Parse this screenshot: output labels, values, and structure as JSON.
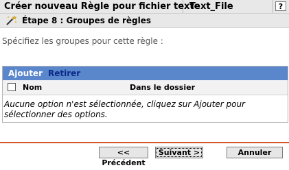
{
  "header": {
    "title": "Créer nouveau Règle pour fichier texte",
    "subtitle": "Text_File",
    "help_label": "?"
  },
  "step": {
    "icon": "wand-icon",
    "title": "Étape 8 : Groupes de règles"
  },
  "instructions": "Spécifiez les groupes pour cette règle :",
  "groups_panel": {
    "toolbar": {
      "add_label": "Ajouter",
      "remove_label": "Retirer"
    },
    "columns": [
      "Nom",
      "Dans le dossier"
    ],
    "rows": [],
    "empty_message": "Aucune option n'est sélectionnée, cliquez sur Ajouter pour sélectionner des options."
  },
  "footer": {
    "prev_label": "<< Précédent",
    "next_label": "Suivant >",
    "cancel_label": "Annuler"
  },
  "colors": {
    "toolbar_bg": "#5a86cc",
    "divider": "#d45a2a",
    "remove_link": "#0a2a88"
  }
}
